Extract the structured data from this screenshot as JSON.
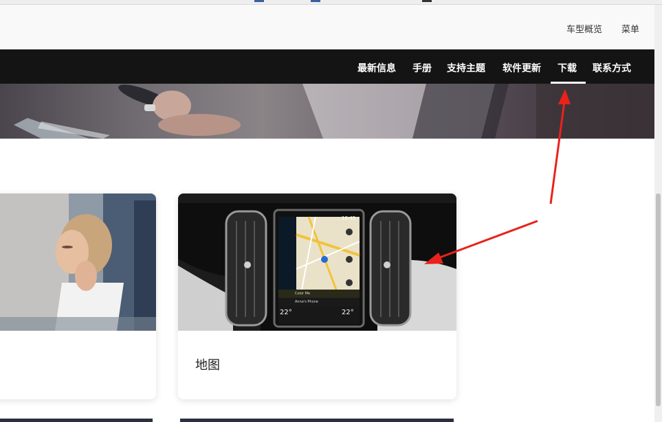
{
  "header": {
    "links": [
      "车型概览",
      "菜单"
    ]
  },
  "nav": {
    "items": [
      "最新信息",
      "手册",
      "支持主题",
      "软件更新",
      "下载",
      "联系方式"
    ],
    "active": "下载"
  },
  "cards": [
    {
      "title": ""
    },
    {
      "title": "地图"
    }
  ],
  "dashboard": {
    "temp_left": "22°",
    "temp_right": "22°",
    "time": "10:45",
    "contact_1": "Color Me",
    "contact_2": "Anna's Phone"
  },
  "colors": {
    "nav_bg": "#141414",
    "annotation": "#e8231b"
  }
}
